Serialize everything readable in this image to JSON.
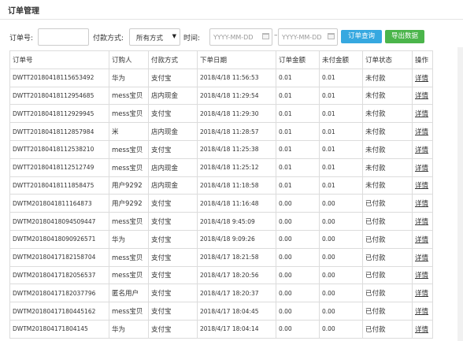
{
  "panel": {
    "title": "订单管理"
  },
  "filters": {
    "order_no_label": "订单号:",
    "order_no_value": "",
    "payment_label": "付款方式:",
    "payment_selected": "所有方式",
    "time_label": "时间:",
    "date_from_placeholder": "YYYY-MM-DD",
    "date_to_placeholder": "YYYY-MM-DD",
    "range_separator": "–",
    "query_button": "订单查询",
    "export_button": "导出数据"
  },
  "table": {
    "columns": [
      "订单号",
      "订购人",
      "付款方式",
      "下单日期",
      "订单金额",
      "未付金额",
      "订单状态",
      "操作"
    ],
    "rows": [
      [
        "DWTT20180418115653492",
        "华为",
        "支付宝",
        "2018/4/18 11:56:53",
        "0.01",
        "0.01",
        "未付款",
        "详情"
      ],
      [
        "DWTT20180418112954685",
        "mess宝贝",
        "店内现金",
        "2018/4/18 11:29:54",
        "0.01",
        "0.01",
        "未付款",
        "详情"
      ],
      [
        "DWTT20180418112929945",
        "mess宝贝",
        "支付宝",
        "2018/4/18 11:29:30",
        "0.01",
        "0.01",
        "未付款",
        "详情"
      ],
      [
        "DWTT20180418112857984",
        "米",
        "店内现金",
        "2018/4/18 11:28:57",
        "0.01",
        "0.01",
        "未付款",
        "详情"
      ],
      [
        "DWTT20180418112538210",
        "mess宝贝",
        "支付宝",
        "2018/4/18 11:25:38",
        "0.01",
        "0.01",
        "未付款",
        "详情"
      ],
      [
        "DWTT20180418112512749",
        "mess宝贝",
        "店内现金",
        "2018/4/18 11:25:12",
        "0.01",
        "0.01",
        "未付款",
        "详情"
      ],
      [
        "DWTT20180418111858475",
        "用户9292",
        "店内现金",
        "2018/4/18 11:18:58",
        "0.01",
        "0.01",
        "未付款",
        "详情"
      ],
      [
        "DWTM2018041811164873",
        "用户9292",
        "支付宝",
        "2018/4/18 11:16:48",
        "0.00",
        "0.00",
        "已付款",
        "详情"
      ],
      [
        "DWTM20180418094509447",
        "mess宝贝",
        "支付宝",
        "2018/4/18 9:45:09",
        "0.00",
        "0.00",
        "已付款",
        "详情"
      ],
      [
        "DWTM20180418090926571",
        "华为",
        "支付宝",
        "2018/4/18 9:09:26",
        "0.00",
        "0.00",
        "已付款",
        "详情"
      ],
      [
        "DWTM20180417182158704",
        "mess宝贝",
        "支付宝",
        "2018/4/17 18:21:58",
        "0.00",
        "0.00",
        "已付款",
        "详情"
      ],
      [
        "DWTM20180417182056537",
        "mess宝贝",
        "支付宝",
        "2018/4/17 18:20:56",
        "0.00",
        "0.00",
        "已付款",
        "详情"
      ],
      [
        "DWTM20180417182037796",
        "匿名用户",
        "支付宝",
        "2018/4/17 18:20:37",
        "0.00",
        "0.00",
        "已付款",
        "详情"
      ],
      [
        "DWTM20180417180445162",
        "mess宝贝",
        "支付宝",
        "2018/4/17 18:04:45",
        "0.00",
        "0.00",
        "已付款",
        "详情"
      ],
      [
        "DWTM201804171804145",
        "华为",
        "支付宝",
        "2018/4/17 18:04:14",
        "0.00",
        "0.00",
        "已付款",
        "详情"
      ]
    ]
  }
}
